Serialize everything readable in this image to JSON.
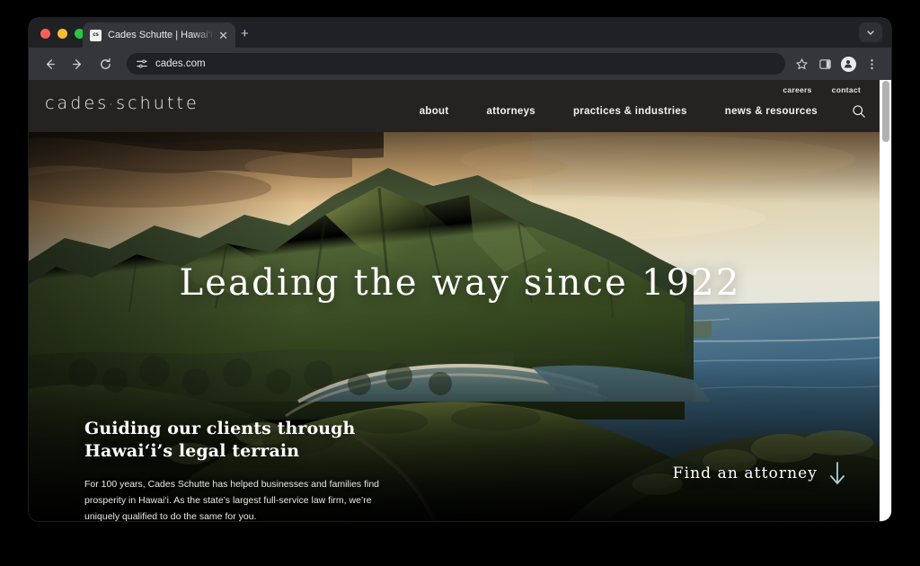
{
  "browser": {
    "tab": {
      "title": "Cades Schutte | Hawai‘i Busin",
      "favicon_label": "cs",
      "close_label": "✕"
    },
    "new_tab_label": "+",
    "toolbar": {
      "back_icon": "back-arrow-icon",
      "forward_icon": "forward-arrow-icon",
      "reload_icon": "reload-icon",
      "site_settings_icon": "sliders-icon",
      "url": "cades.com",
      "bookmark_icon": "star-icon",
      "side_panel_icon": "side-panel-icon",
      "profile_icon": "avatar-icon",
      "menu_icon": "three-dot-menu-icon"
    },
    "tab_list_icon": "chevron-down-icon"
  },
  "site": {
    "logo": {
      "part1": "cades",
      "separator": "·",
      "part2": "schutte"
    },
    "utility_nav": [
      {
        "label": "careers"
      },
      {
        "label": "contact"
      }
    ],
    "main_nav": [
      {
        "label": "about"
      },
      {
        "label": "attorneys"
      },
      {
        "label": "practices & industries"
      },
      {
        "label": "news & resources"
      }
    ],
    "search_icon": "search-icon"
  },
  "hero": {
    "headline": "Leading the way since 1922",
    "subheadline": "Guiding our clients through Hawai‘i’s legal terrain",
    "paragraph": "For 100 years, Cades Schutte has helped businesses and families find prosperity in Hawai‘i. As the state’s largest full-service law firm, we’re uniquely qualified to do the same for you.",
    "cta_label": "Find an attorney",
    "cta_icon": "arrow-down-icon",
    "cta_arrow_color": "#a9cfdd"
  },
  "colors": {
    "header_bg": "#242321",
    "browser_chrome": "#202124",
    "toolbar_bg": "#35363a",
    "desktop_bg": "#000000",
    "text_light": "#ffffff"
  }
}
